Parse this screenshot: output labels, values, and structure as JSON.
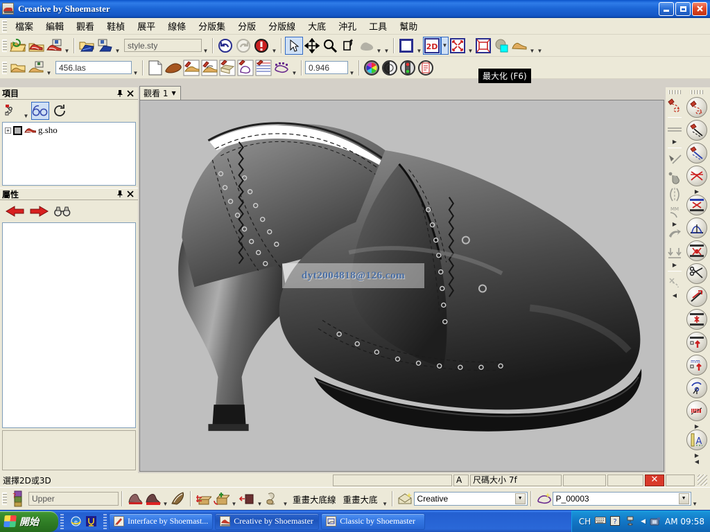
{
  "window": {
    "title": "Creative by Shoemaster",
    "icon": "shoe-icon",
    "minimize_label": "_",
    "maximize_label": "□",
    "close_label": "✕"
  },
  "menu": {
    "items": [
      {
        "label": "檔案",
        "name": "file"
      },
      {
        "label": "編輯",
        "name": "edit"
      },
      {
        "label": "觀看",
        "name": "view"
      },
      {
        "label": "鞋楨",
        "name": "last"
      },
      {
        "label": "展平",
        "name": "flatten"
      },
      {
        "label": "線條",
        "name": "lines"
      },
      {
        "label": "分版集",
        "name": "pattern-set"
      },
      {
        "label": "分版",
        "name": "pattern"
      },
      {
        "label": "分版線",
        "name": "pattern-line"
      },
      {
        "label": "大底",
        "name": "sole"
      },
      {
        "label": "沖孔",
        "name": "punch"
      },
      {
        "label": "工具",
        "name": "tools"
      },
      {
        "label": "幫助",
        "name": "help"
      }
    ]
  },
  "toolbar_top": {
    "style_file": "style.sty",
    "style_placeholder": "style.sty",
    "icons": [
      "open-style-icon",
      "open-shoe-icon",
      "save-shoe-icon",
      "open-export-icon",
      "save-export-icon",
      "undo-icon",
      "redo-icon",
      "stop-icon",
      "select-arrow-icon",
      "pan-icon",
      "zoom-icon",
      "rotate-icon",
      "shade-icon",
      "background-icon",
      "2d-toggle-icon",
      "fit-icon",
      "frame-icon",
      "overlay-icon",
      "shoe-view-icon"
    ],
    "view_mode_label": "2D"
  },
  "toolbar_second": {
    "last_file": "456.las",
    "last_placeholder": "456.las",
    "scale_value": "0.946",
    "icons": [
      "open-last-icon",
      "save-last-icon",
      "new-page-icon",
      "sole-icon",
      "last-shape-icon",
      "last-pattern-icon",
      "box-icon",
      "pattern-edit-icon",
      "grid-pattern-icon",
      "outline-icon",
      "color-wheel-icon",
      "contrast-icon",
      "traffic-light-icon",
      "notes-icon"
    ]
  },
  "tooltip": {
    "text": "最大化 (F6)"
  },
  "panels": {
    "items": {
      "title": "項目",
      "pin_label": "⚓",
      "close_label": "✕",
      "tools": [
        "filter-icon",
        "glasses-icon",
        "refresh-icon"
      ],
      "tree": [
        {
          "label": "g.sho",
          "expand": "+",
          "icon": "shoe-icon"
        }
      ]
    },
    "properties": {
      "title": "屬性",
      "pin_label": "⚓",
      "close_label": "✕",
      "tools": [
        "back-arrow-icon",
        "forward-arrow-icon",
        "binoculars-icon"
      ]
    }
  },
  "viewport": {
    "tab_label": "觀看 1",
    "tab_arrow": "▼",
    "watermark": "dyt2004818@126.com",
    "background_color": "#bfbfbf"
  },
  "right_toolbar_outer": {
    "icons": [
      "pen-shape-icon",
      "parallel-lines-icon",
      "arrow-more-icon",
      "slash-line-icon",
      "point-hand-icon",
      "mirror-icon",
      "mm-shape-icon",
      "arrow-more-2-icon",
      "fold-arrow-icon",
      "down-arrows-icon",
      "arrow-more-3-icon",
      "curve-cross-icon",
      "arrow-left-icon"
    ]
  },
  "right_toolbar_inner": {
    "icons": [
      "pen-curve-icon",
      "pen-line-icon",
      "pen-blue-line-icon",
      "scissors-cross-icon",
      "arrow-more-icon",
      "flatten-table-icon",
      "perpendicular-icon",
      "stretch-table-icon",
      "cut-scissors-icon",
      "measure-arrow-icon",
      "compress-icon",
      "grade-up-icon",
      "mm-up-icon",
      "rotate-point-icon",
      "grade-pattern-icon",
      "arrow-more-2-icon",
      "text-label-icon",
      "arrow-more-3-icon",
      "arrow-left-icon"
    ]
  },
  "statusbar": {
    "message": "選擇2D或3D",
    "cells": [
      {
        "name": "blank-1",
        "value": ""
      },
      {
        "name": "mode-letter",
        "value": "A"
      },
      {
        "name": "size-field",
        "value": "尺碼大小 7f"
      },
      {
        "name": "blank-2",
        "value": ""
      },
      {
        "name": "blank-3",
        "value": ""
      },
      {
        "name": "stop-indicator",
        "value": ""
      },
      {
        "name": "blank-4",
        "value": ""
      }
    ]
  },
  "bottombar": {
    "mode_field": "Upper",
    "mode_placeholder": "Upper",
    "icons": [
      "layers-icon",
      "shoe-red-icon",
      "shoe-red-filled-icon",
      "brush-icon",
      "move-part-icon",
      "add-part-icon",
      "material-icon",
      "shade-part-icon"
    ],
    "labels": [
      {
        "text": "重畫大底線",
        "name": "redraw-sole-line"
      },
      {
        "text": "重畫大底",
        "name": "redraw-sole"
      }
    ],
    "combo_model": "Creative",
    "combo_part": "P_00003"
  },
  "taskbar": {
    "start_label": "開始",
    "quick_launch": [
      "ie-icon",
      "app-icon"
    ],
    "tasks": [
      {
        "label": "Interface by Shoemast...",
        "icon": "interface-icon",
        "active": false
      },
      {
        "label": "Creative by Shoemaster",
        "icon": "creative-icon",
        "active": true
      },
      {
        "label": "Classic by Shoemaster",
        "icon": "classic-icon",
        "active": false
      }
    ],
    "tray": {
      "ime": "CH",
      "icons": [
        "keyboard-icon",
        "help-icon",
        "network-icon"
      ],
      "show_hidden": "◀",
      "clock": "AM 09:58"
    }
  },
  "colors": {
    "title_blue": "#1c66d6",
    "face": "#ece9d8",
    "canvas": "#bfbfbf",
    "accent_red": "#d93a2b",
    "select_blue": "#316ac5"
  }
}
